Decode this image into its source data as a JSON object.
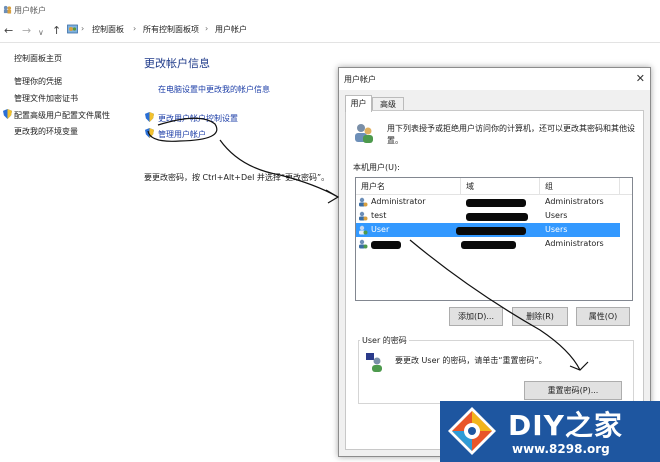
{
  "window": {
    "title": "用户帐户"
  },
  "breadcrumb": [
    "控制面板",
    "所有控制面板项",
    "用户帐户"
  ],
  "sidebar": {
    "home": "控制面板主页",
    "items": [
      "管理你的凭据",
      "管理文件加密证书",
      "配置高级用户配置文件属性",
      "更改我的环境变量"
    ]
  },
  "main": {
    "heading": "更改帐户信息",
    "link1": "在电脑设置中更改我的帐户信息",
    "link2": "更改用户帐户控制设置",
    "link3": "管理用户帐户",
    "hint": "要更改密码，按 Ctrl+Alt+Del 并选择“更改密码”。"
  },
  "dialog": {
    "title": "用户帐户",
    "close": "✕",
    "tabs": [
      "用户",
      "高级"
    ],
    "description": "用下列表授予或拒绝用户访问你的计算机，还可以更改其密码和其他设置。",
    "list_label": "本机用户(U):",
    "columns": [
      "用户名",
      "域",
      "组"
    ],
    "rows": [
      {
        "name": "Administrator",
        "group": "Administrators"
      },
      {
        "name": "test",
        "group": "Users"
      },
      {
        "name": "User",
        "group": "Users"
      },
      {
        "name": "",
        "group": "Administrators"
      }
    ],
    "buttons": {
      "add": "添加(D)...",
      "remove": "删除(R)",
      "props": "属性(O)"
    },
    "pwd_group": "User 的密码",
    "pwd_text": "要更改 User 的密码，请单击“重置密码”。",
    "reset": "重置密码(P)..."
  },
  "watermark": {
    "name": "DIY之家",
    "url": "www.8298.org"
  }
}
